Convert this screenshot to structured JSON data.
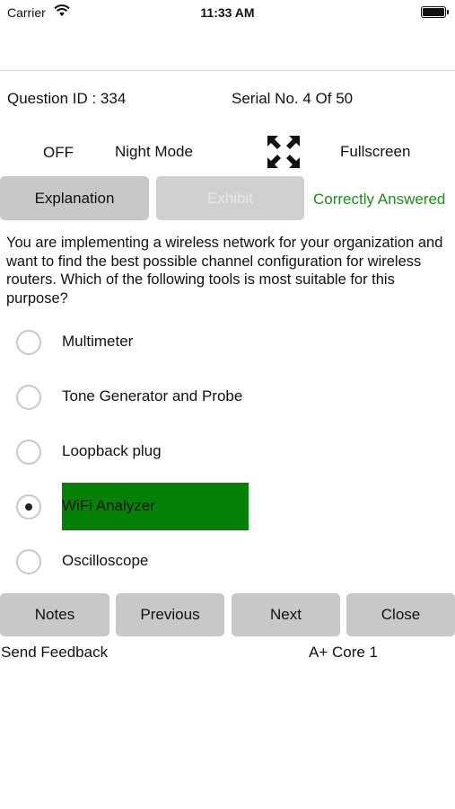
{
  "status_bar": {
    "carrier": "Carrier",
    "time": "11:33 AM",
    "battery_icon": "battery-icon",
    "wifi_icon": "wifi-icon"
  },
  "info": {
    "question_id": "Question ID : 334",
    "serial": "Serial No. 4 Of 50"
  },
  "mode": {
    "off": "OFF",
    "night_mode": "Night Mode",
    "fullscreen_icon": "fullscreen-icon",
    "fullscreen": "Fullscreen"
  },
  "actions": {
    "explanation": "Explanation",
    "exhibit": "Exhibit",
    "status": "Correctly Answered",
    "status_color": "#1f8b1f"
  },
  "question": {
    "text": "You are implementing a wireless network for your organization and want to find the best possible channel configuration for wireless routers. Which of the following tools is most suitable for this purpose?"
  },
  "options": [
    {
      "label": "Multimeter",
      "selected": false,
      "correct": false
    },
    {
      "label": "Tone Generator and Probe",
      "selected": false,
      "correct": false
    },
    {
      "label": "Loopback plug",
      "selected": false,
      "correct": false
    },
    {
      "label": "WiFi Analyzer",
      "selected": true,
      "correct": true
    },
    {
      "label": "Oscilloscope",
      "selected": false,
      "correct": false
    }
  ],
  "colors": {
    "correct_highlight": "#078007",
    "button_bg": "#c8c8c8"
  },
  "footer": {
    "notes": "Notes",
    "previous": "Previous",
    "next": "Next",
    "close": "Close",
    "feedback": "Send Feedback",
    "exam": "A+ Core 1"
  }
}
